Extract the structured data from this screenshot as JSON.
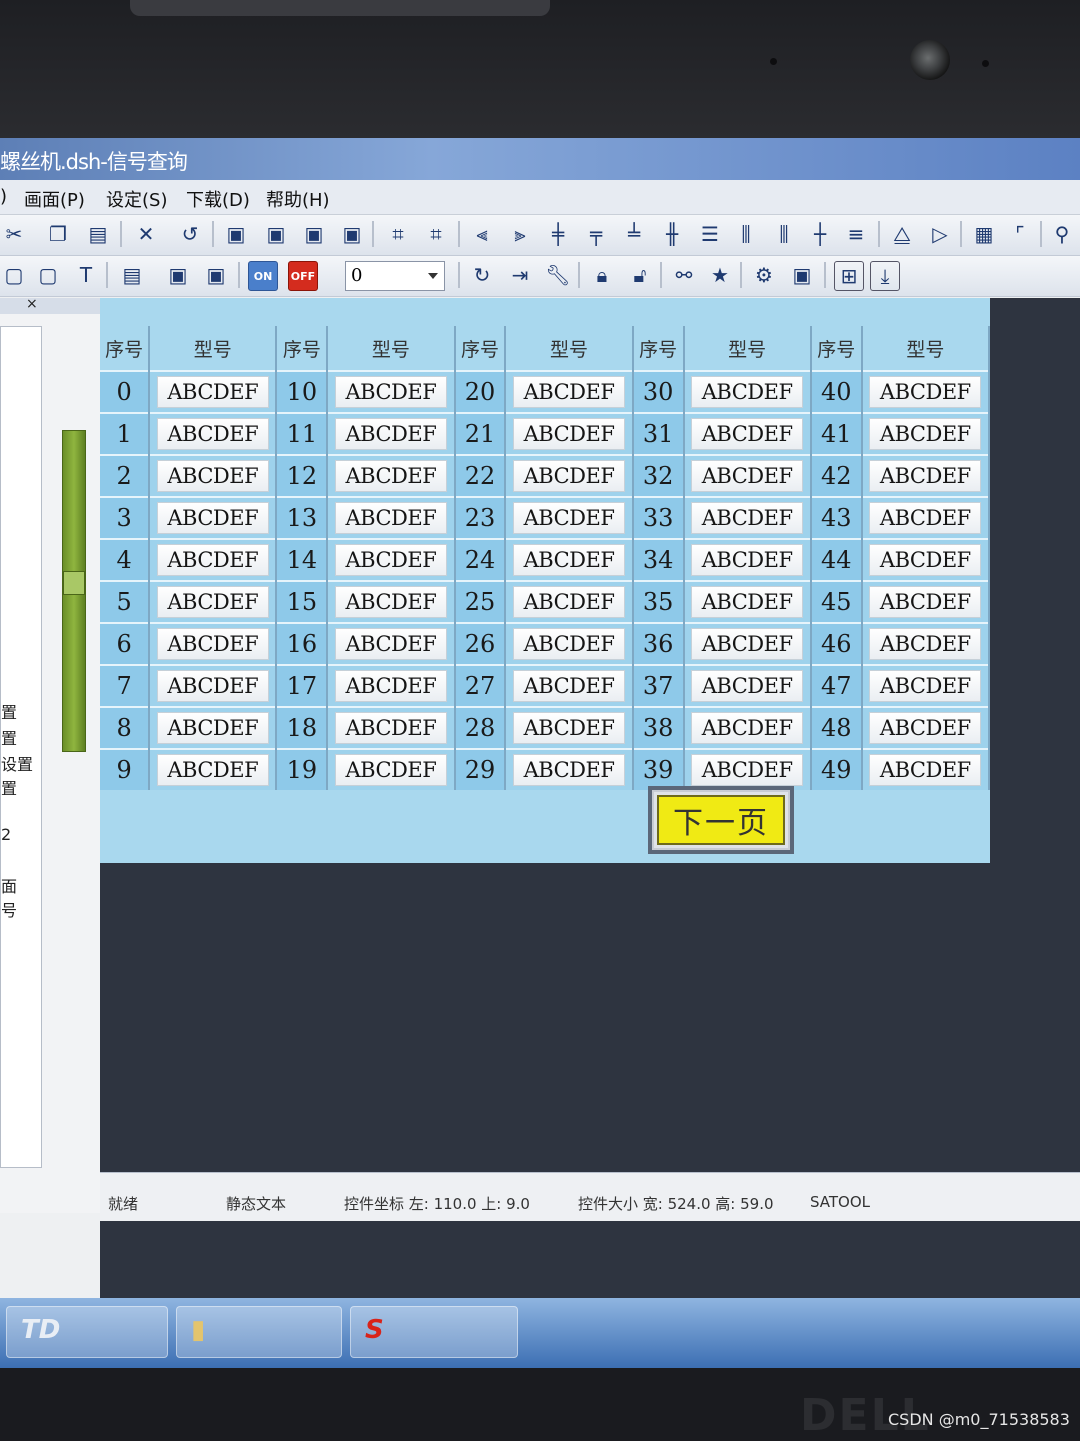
{
  "window": {
    "title": "螺丝机.dsh-信号查询"
  },
  "menu": [
    {
      "label": "画面(P)"
    },
    {
      "label": "设定(S)"
    },
    {
      "label": "下载(D)"
    },
    {
      "label": "帮助(H)"
    }
  ],
  "toolbar2": {
    "combo_value": "0",
    "on_label": "ON",
    "off_label": "OFF"
  },
  "left_panel": {
    "items": [
      "置",
      "置",
      "设置",
      "置",
      "2",
      "面",
      "号"
    ]
  },
  "table": {
    "headers": [
      "序号",
      "型号",
      "序号",
      "型号",
      "序号",
      "型号",
      "序号",
      "型号",
      "序号",
      "型号"
    ],
    "rows": [
      [
        "0",
        "ABCDEF",
        "10",
        "ABCDEF",
        "20",
        "ABCDEF",
        "30",
        "ABCDEF",
        "40",
        "ABCDEF"
      ],
      [
        "1",
        "ABCDEF",
        "11",
        "ABCDEF",
        "21",
        "ABCDEF",
        "31",
        "ABCDEF",
        "41",
        "ABCDEF"
      ],
      [
        "2",
        "ABCDEF",
        "12",
        "ABCDEF",
        "22",
        "ABCDEF",
        "32",
        "ABCDEF",
        "42",
        "ABCDEF"
      ],
      [
        "3",
        "ABCDEF",
        "13",
        "ABCDEF",
        "23",
        "ABCDEF",
        "33",
        "ABCDEF",
        "43",
        "ABCDEF"
      ],
      [
        "4",
        "ABCDEF",
        "14",
        "ABCDEF",
        "24",
        "ABCDEF",
        "34",
        "ABCDEF",
        "44",
        "ABCDEF"
      ],
      [
        "5",
        "ABCDEF",
        "15",
        "ABCDEF",
        "25",
        "ABCDEF",
        "35",
        "ABCDEF",
        "45",
        "ABCDEF"
      ],
      [
        "6",
        "ABCDEF",
        "16",
        "ABCDEF",
        "26",
        "ABCDEF",
        "36",
        "ABCDEF",
        "46",
        "ABCDEF"
      ],
      [
        "7",
        "ABCDEF",
        "17",
        "ABCDEF",
        "27",
        "ABCDEF",
        "37",
        "ABCDEF",
        "47",
        "ABCDEF"
      ],
      [
        "8",
        "ABCDEF",
        "18",
        "ABCDEF",
        "28",
        "ABCDEF",
        "38",
        "ABCDEF",
        "48",
        "ABCDEF"
      ],
      [
        "9",
        "ABCDEF",
        "19",
        "ABCDEF",
        "29",
        "ABCDEF",
        "39",
        "ABCDEF",
        "49",
        "ABCDEF"
      ]
    ]
  },
  "next_button": {
    "label": "下一页"
  },
  "status": {
    "ready": "就绪",
    "object_type": "静态文本",
    "coords": "控件坐标 左: 110.0 上: 9.0",
    "size": "控件大小 宽: 524.0 高: 59.0",
    "app": "SATOOL"
  },
  "brand": "DELL",
  "watermark": "CSDN @m0_71538583",
  "colors": {
    "page_bg": "#a9d8ee",
    "next_button": "#f0ea14",
    "off_icon": "#d42c1e"
  }
}
